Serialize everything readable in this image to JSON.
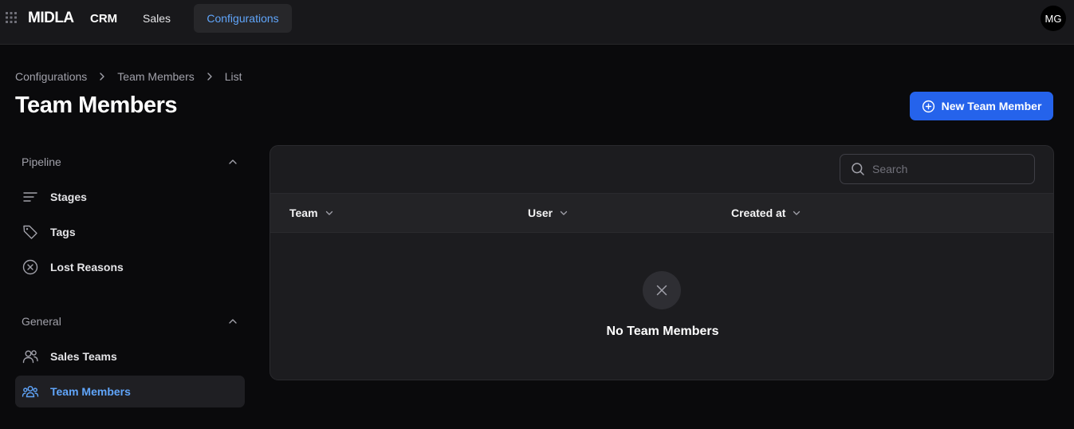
{
  "topbar": {
    "brand": "MIDLA",
    "app_name": "CRM",
    "nav": [
      {
        "label": "Sales",
        "active": false
      },
      {
        "label": "Configurations",
        "active": true
      }
    ],
    "user_initials": "MG"
  },
  "breadcrumb": [
    "Configurations",
    "Team Members",
    "List"
  ],
  "page": {
    "title": "Team Members",
    "new_button_label": "New Team Member"
  },
  "sidebar": {
    "groups": [
      {
        "label": "Pipeline",
        "items": [
          {
            "label": "Stages",
            "icon": "stages-icon"
          },
          {
            "label": "Tags",
            "icon": "tag-icon"
          },
          {
            "label": "Lost Reasons",
            "icon": "x-circle-icon"
          }
        ]
      },
      {
        "label": "General",
        "items": [
          {
            "label": "Sales Teams",
            "icon": "users-icon"
          },
          {
            "label": "Team Members",
            "icon": "user-group-icon",
            "active": true
          }
        ]
      }
    ]
  },
  "table": {
    "search_placeholder": "Search",
    "columns": [
      "Team",
      "User",
      "Created at"
    ],
    "rows": [],
    "empty_text": "No Team Members"
  },
  "colors": {
    "accent": "#2563eb",
    "active_text": "#60a5fa",
    "background": "#0a0a0c"
  }
}
